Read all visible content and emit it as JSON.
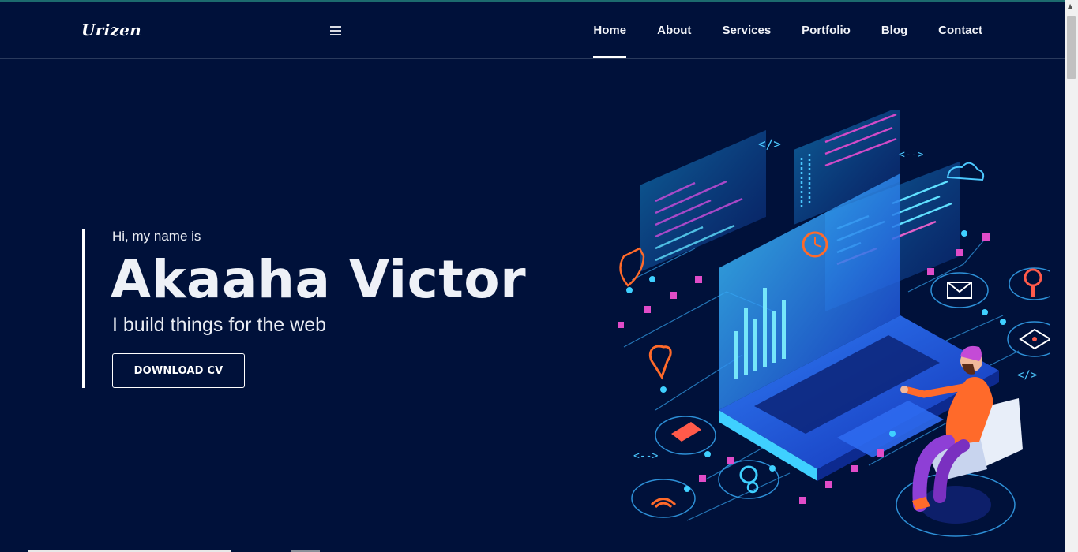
{
  "nav": {
    "logo": "Urizen",
    "links": [
      "Home",
      "About",
      "Services",
      "Portfolio",
      "Blog",
      "Contact"
    ],
    "active": "Home"
  },
  "hero": {
    "greeting": "Hi, my name is",
    "name": "Akaaha Victor",
    "tagline": "I build things for the web",
    "button": "DOWNLOAD CV"
  },
  "illustration": {
    "code_tags": [
      "</>",
      "<-->",
      "</>",
      "<-->"
    ]
  },
  "colors": {
    "background": "#00113a",
    "accent_cyan": "#3fd0ff",
    "accent_pink": "#e04cc8",
    "accent_orange": "#ff6a2a"
  }
}
